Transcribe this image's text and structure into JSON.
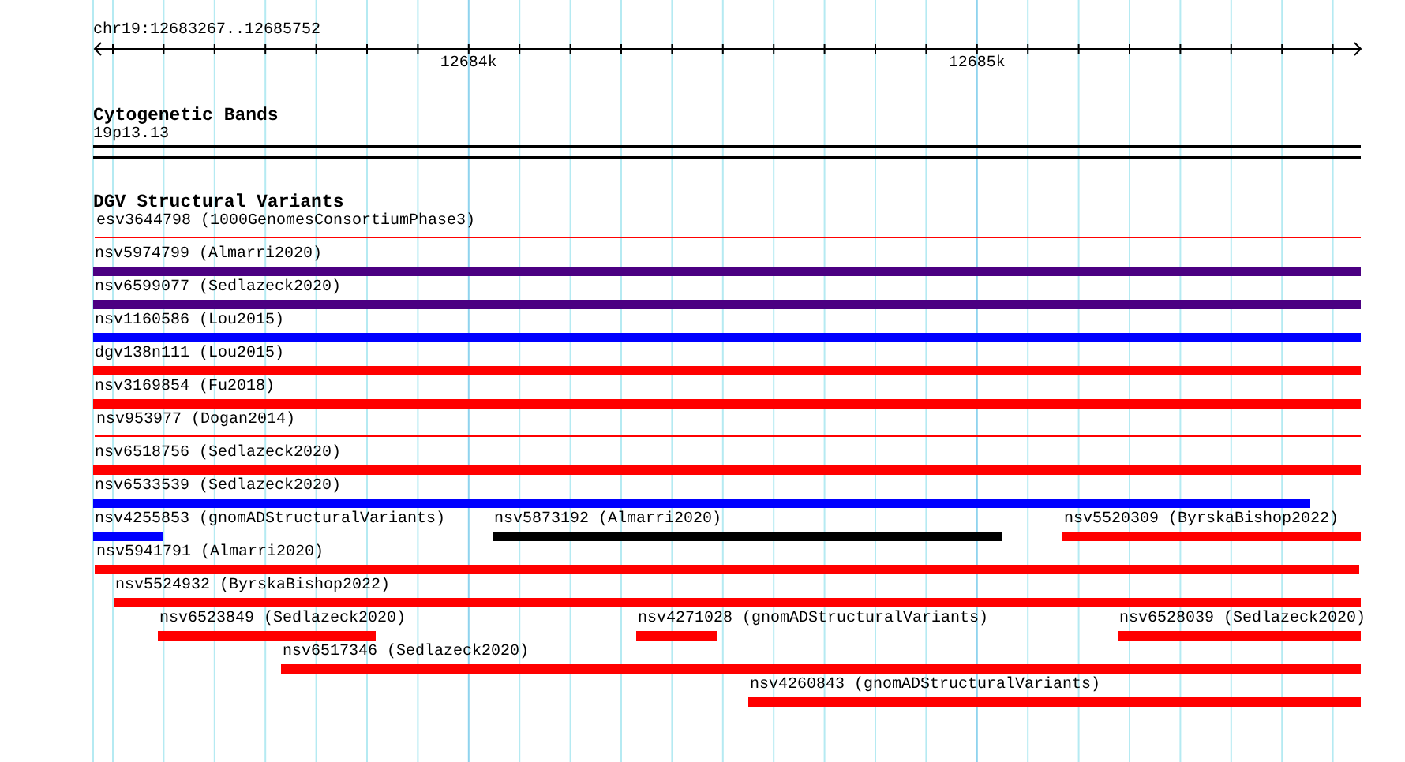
{
  "location": "chr19:12683267..12685752",
  "ruler": {
    "tick_labels": [
      "12684k",
      "12685k"
    ]
  },
  "cytogenetic_bands": {
    "title": "Cytogenetic Bands",
    "band": "19p13.13"
  },
  "dgv": {
    "title": "DGV Structural Variants",
    "rows": [
      {
        "features": [
          {
            "label": "esv3644798 (1000GenomesConsortiumPhase3)",
            "kind": "line",
            "color": "#ff0000"
          }
        ]
      },
      {
        "features": [
          {
            "label": "nsv5974799 (Almarri2020)",
            "kind": "bar",
            "color": "#4b0082"
          }
        ]
      },
      {
        "features": [
          {
            "label": "nsv6599077 (Sedlazeck2020)",
            "kind": "bar",
            "color": "#4b0082"
          }
        ]
      },
      {
        "features": [
          {
            "label": "nsv1160586 (Lou2015)",
            "kind": "bar",
            "color": "#0000ff"
          }
        ]
      },
      {
        "features": [
          {
            "label": "dgv138n111 (Lou2015)",
            "kind": "bar",
            "color": "#ff0000"
          }
        ]
      },
      {
        "features": [
          {
            "label": "nsv3169854 (Fu2018)",
            "kind": "bar",
            "color": "#ff0000"
          }
        ]
      },
      {
        "features": [
          {
            "label": "nsv953977 (Dogan2014)",
            "kind": "line",
            "color": "#ff0000"
          }
        ]
      },
      {
        "features": [
          {
            "label": "nsv6518756 (Sedlazeck2020)",
            "kind": "bar",
            "color": "#ff0000"
          }
        ]
      },
      {
        "features": [
          {
            "label": "nsv6533539 (Sedlazeck2020)",
            "kind": "bar",
            "color": "#0000ff"
          }
        ]
      },
      {
        "features": [
          {
            "label": "nsv4255853 (gnomADStructuralVariants)",
            "kind": "bar",
            "color": "#0000ff"
          },
          {
            "label": "nsv5873192 (Almarri2020)",
            "kind": "bar",
            "color": "#000000"
          },
          {
            "label": "nsv5520309 (ByrskaBishop2022)",
            "kind": "bar",
            "color": "#ff0000"
          }
        ]
      },
      {
        "features": [
          {
            "label": "nsv5941791 (Almarri2020)",
            "kind": "bar",
            "color": "#ff0000"
          }
        ]
      },
      {
        "features": [
          {
            "label": "nsv5524932 (ByrskaBishop2022)",
            "kind": "bar",
            "color": "#ff0000"
          }
        ]
      },
      {
        "features": [
          {
            "label": "nsv6523849 (Sedlazeck2020)",
            "kind": "bar",
            "color": "#ff0000"
          },
          {
            "label": "nsv4271028 (gnomADStructuralVariants)",
            "kind": "bar",
            "color": "#ff0000"
          },
          {
            "label": "nsv6528039 (Sedlazeck2020)",
            "kind": "bar",
            "color": "#ff0000"
          }
        ]
      },
      {
        "features": [
          {
            "label": "nsv6517346 (Sedlazeck2020)",
            "kind": "bar",
            "color": "#ff0000"
          }
        ]
      },
      {
        "features": [
          {
            "label": "nsv4260843 (gnomADStructuralVariants)",
            "kind": "bar",
            "color": "#ff0000"
          }
        ]
      }
    ]
  }
}
